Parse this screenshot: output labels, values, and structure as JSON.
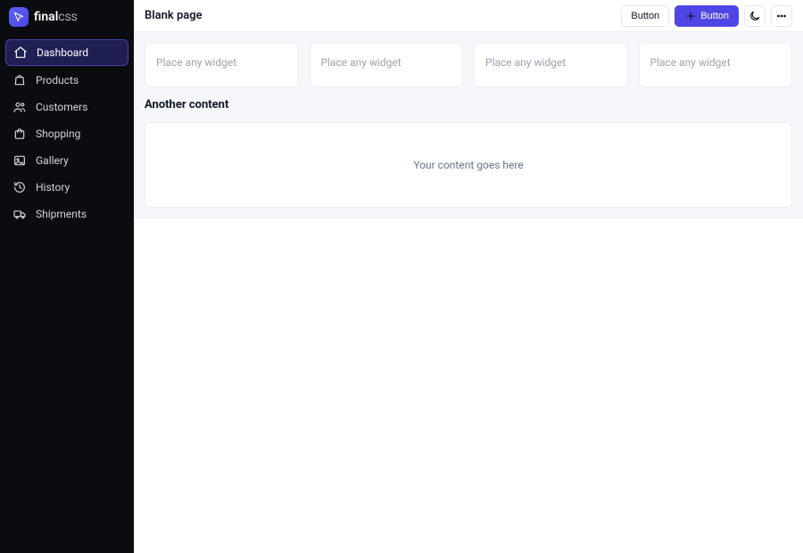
{
  "brand": {
    "name_bold": "final",
    "name_light": "css"
  },
  "sidebar": {
    "items": [
      {
        "label": "Dashboard"
      },
      {
        "label": "Products"
      },
      {
        "label": "Customers"
      },
      {
        "label": "Shopping"
      },
      {
        "label": "Gallery"
      },
      {
        "label": "History"
      },
      {
        "label": "Shipments"
      }
    ]
  },
  "header": {
    "title": "Blank page",
    "button_secondary": "Button",
    "button_primary": "Button"
  },
  "widgets": {
    "placeholder": "Place any widget"
  },
  "section": {
    "title": "Another content",
    "body": "Your content goes here"
  }
}
